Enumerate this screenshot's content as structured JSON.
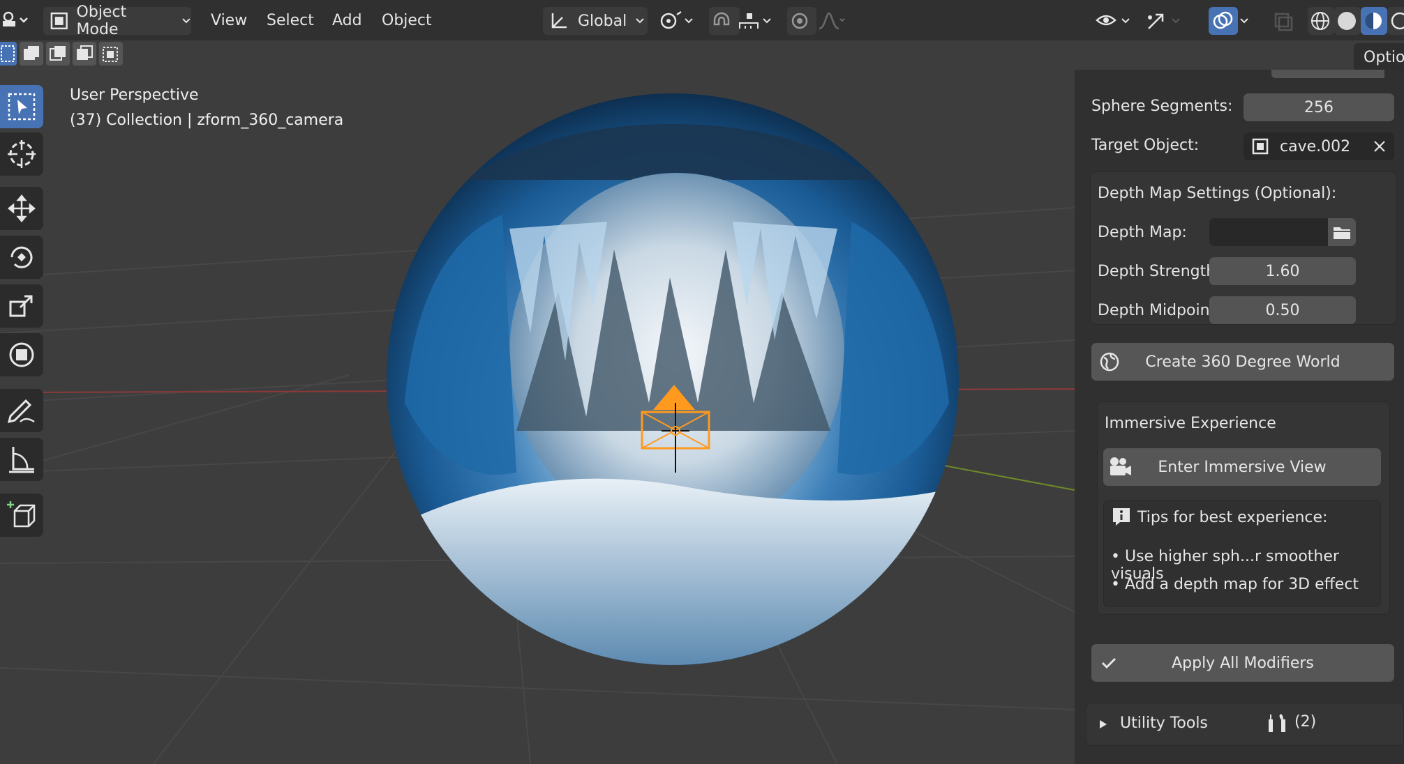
{
  "header": {
    "mode": "Object Mode",
    "menu": [
      "View",
      "Select",
      "Add",
      "Object"
    ],
    "transform_orientation": "Global"
  },
  "options_tab": "Options",
  "viewport": {
    "perspective": "User Perspective",
    "collection_info": "(37) Collection | zform_360_camera"
  },
  "sidebar": {
    "sphere_segments_label": "Sphere Segments:",
    "sphere_segments_value": "256",
    "target_object_label": "Target Object:",
    "target_object_value": "cave.002",
    "depth_section_title": "Depth Map Settings (Optional):",
    "depth_map_label": "Depth Map:",
    "depth_strength_label": "Depth Strength:",
    "depth_strength_value": "1.60",
    "depth_midpoint_label": "Depth Midpoint:",
    "depth_midpoint_value": "0.50",
    "create_world_button": "Create 360 Degree World",
    "immersive_title": "Immersive Experience",
    "enter_immersive_button": "Enter Immersive View",
    "tips_title": "Tips for best experience:",
    "tips": [
      "• Use higher sph...r smoother visuals",
      "• Add a depth map for 3D effect"
    ],
    "apply_modifiers_button": "Apply All Modifiers",
    "utility_tools_label": "Utility Tools",
    "utility_tools_count": "(2)"
  },
  "colors": {
    "accent_blue": "#4772b3",
    "camera_orange": "#ff9a1f",
    "background": "#3d3d3d"
  }
}
